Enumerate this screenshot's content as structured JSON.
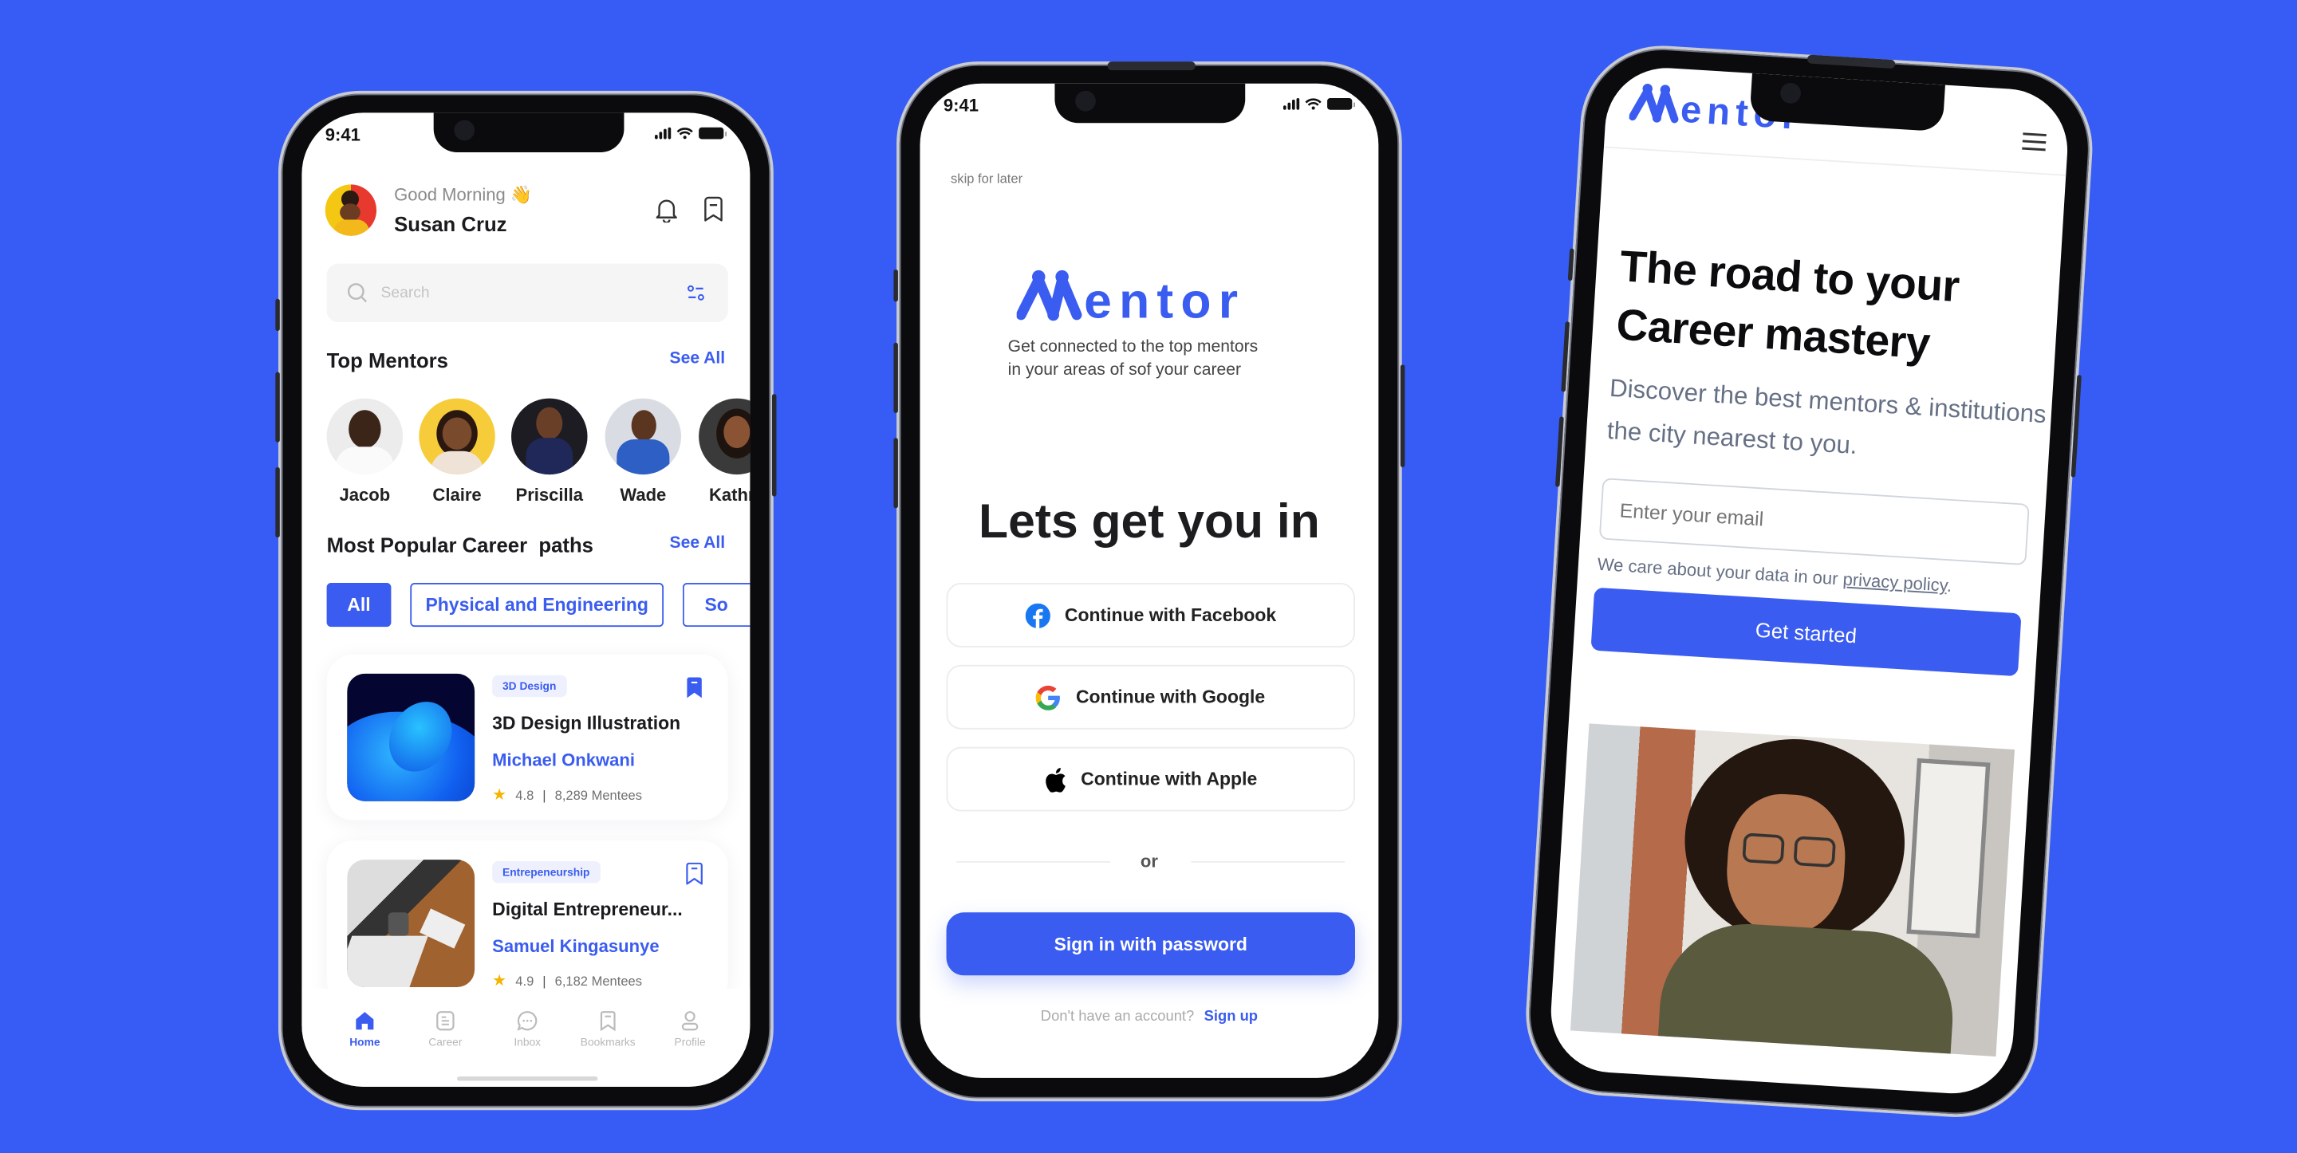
{
  "colors": {
    "background": "#375cf5",
    "accent": "#3a5cf0",
    "text": "#1b1b1f",
    "muted": "#9a9a9a"
  },
  "status_bar": {
    "time": "9:41"
  },
  "home_screen": {
    "greeting": "Good Morning 👋",
    "user_name": "Susan Cruz",
    "icons": [
      "bell-icon",
      "bookmark-icon"
    ],
    "search": {
      "placeholder": "Search",
      "filter_icon": "sliders-icon"
    },
    "top_mentors": {
      "title": "Top Mentors",
      "see_all": "See All",
      "mentors": [
        {
          "name": "Jacob"
        },
        {
          "name": "Claire"
        },
        {
          "name": "Priscilla"
        },
        {
          "name": "Wade"
        },
        {
          "name": "Kathry"
        }
      ]
    },
    "career_paths": {
      "title": "Most Popular Career  paths",
      "see_all": "See All",
      "chips": [
        {
          "label": "All",
          "selected": true
        },
        {
          "label": "Physical and Engineering",
          "selected": false
        },
        {
          "label": "So",
          "selected": false
        }
      ]
    },
    "courses": [
      {
        "tag": "3D Design",
        "title": "3D Design Illustration",
        "mentor": "Michael Onkwani",
        "rating": "4.8",
        "mentees": "8,289 Mentees",
        "bookmarked": true
      },
      {
        "tag": "Entrepeneurship",
        "title": "Digital Entrepreneur...",
        "mentor": "Samuel Kingasunye",
        "rating": "4.9",
        "mentees": "6,182 Mentees",
        "bookmarked": false
      }
    ],
    "tab_bar": [
      {
        "label": "Home",
        "icon": "home-icon",
        "active": true
      },
      {
        "label": "Career",
        "icon": "document-icon",
        "active": false
      },
      {
        "label": "Inbox",
        "icon": "chat-icon",
        "active": false
      },
      {
        "label": "Bookmarks",
        "icon": "bookmark-icon",
        "active": false
      },
      {
        "label": "Profile",
        "icon": "user-icon",
        "active": false
      }
    ]
  },
  "login_screen": {
    "skip": "skip for later",
    "brand": "Mentor",
    "tagline": "Get connected to the top mentors in your areas of sof your career",
    "heading": "Lets get you in",
    "facebook": "Continue with Facebook",
    "google": "Continue with Google",
    "apple": "Continue with Apple",
    "divider": "or",
    "password_button": "Sign in with password",
    "no_account": "Don't have an account?",
    "sign_up": "Sign up"
  },
  "landing_screen": {
    "brand": "Mentor",
    "menu_icon": "hamburger-icon",
    "heading": "The road to your Career mastery",
    "subheading": "Discover the best mentors & institutions the city nearest to you.",
    "email_placeholder": "Enter your email",
    "privacy_prefix": "We care about your data in our ",
    "privacy_link": "privacy policy",
    "privacy_suffix": ".",
    "cta": "Get started"
  }
}
